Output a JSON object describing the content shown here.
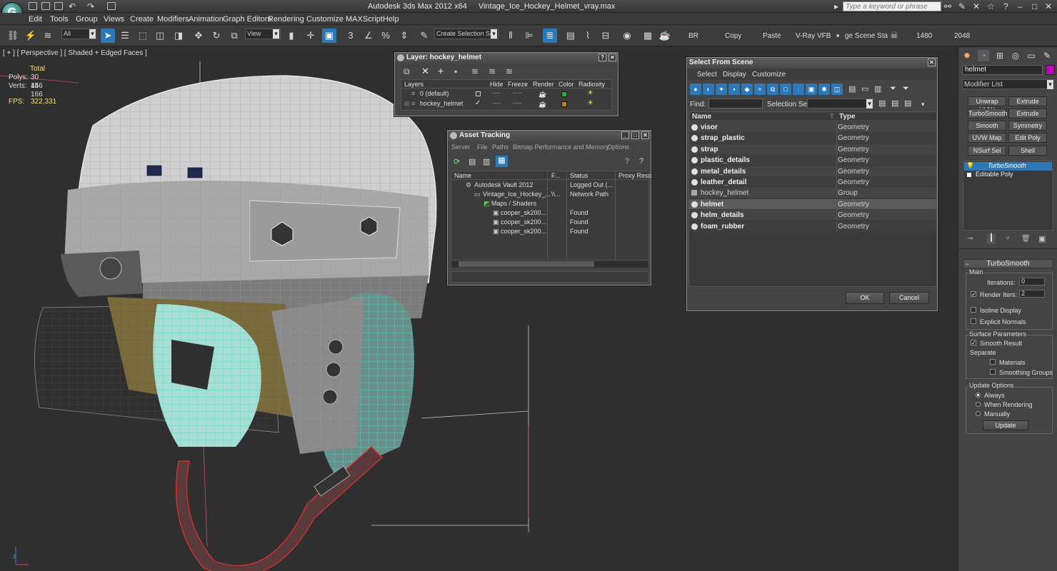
{
  "app": {
    "title": "Autodesk 3ds Max  2012 x64",
    "file": "Vintage_Ice_Hockey_Helmet_vray.max",
    "search_placeholder": "Type a keyword or phrase",
    "logo": "G"
  },
  "menu": [
    "Edit",
    "Tools",
    "Group",
    "Views",
    "Create",
    "Modifiers",
    "Animation",
    "Graph Editors",
    "Rendering",
    "Customize",
    "MAXScript",
    "Help"
  ],
  "toolbar": {
    "filter": "All",
    "ref_coord": "View",
    "selection_set": "Create Selection Se",
    "snap_label": "3",
    "angle_snap": "%",
    "labels": {
      "br": "BR",
      "copy": "Copy",
      "paste": "Paste",
      "vray_vfb": "V-Ray VFB",
      "save_scene": "ge Scene Sta",
      "width": "1480",
      "height": "2048"
    }
  },
  "viewport": {
    "label": "[ + ] [ Perspective ] [ Shaded + Edged Faces ]",
    "stats": {
      "total_label": "Total",
      "polys_label": "Polys:",
      "polys": "30 446",
      "verts_label": "Verts:",
      "verts": "15 166",
      "fps_label": "FPS:",
      "fps": "322,331"
    },
    "axis_label": "z"
  },
  "layer_window": {
    "title": "Layer: hockey_helmet",
    "columns": [
      "Layers",
      "Hide",
      "Freeze",
      "Render",
      "Color",
      "Radiosity"
    ],
    "rows": [
      {
        "name": "0 (default)",
        "color": "#23b14d"
      },
      {
        "name": "hockey_helmet",
        "color": "#b8860b"
      }
    ]
  },
  "asset_window": {
    "title": "Asset Tracking",
    "menu": [
      "Server",
      "File",
      "Paths",
      "Bitmap Performance and Memory",
      "Options"
    ],
    "columns": [
      "Name",
      "F...",
      "Status",
      "Proxy Reso"
    ],
    "rows": [
      {
        "name": "Autodesk Vault 2012",
        "f": "",
        "status": "Logged Out (..."
      },
      {
        "name": "Vintage_Ice_Hockey_...",
        "f": "\\\\...",
        "status": "Network Path"
      },
      {
        "name": "Maps / Shaders",
        "f": "",
        "status": ""
      },
      {
        "name": "cooper_sk200...",
        "f": "",
        "status": "Found"
      },
      {
        "name": "cooper_sk200...",
        "f": "",
        "status": "Found"
      },
      {
        "name": "cooper_sk200...",
        "f": "",
        "status": "Found"
      }
    ]
  },
  "select_window": {
    "title": "Select From Scene",
    "menu": [
      "Select",
      "Display",
      "Customize"
    ],
    "find_label": "Find:",
    "selection_set_label": "Selection Set:",
    "columns": [
      "Name",
      "Type"
    ],
    "rows": [
      {
        "name": "visor",
        "type": "Geometry",
        "group": false,
        "selected": false
      },
      {
        "name": "strap_plastic",
        "type": "Geometry",
        "group": false,
        "selected": false
      },
      {
        "name": "strap",
        "type": "Geometry",
        "group": false,
        "selected": false
      },
      {
        "name": "plastic_details",
        "type": "Geometry",
        "group": false,
        "selected": false
      },
      {
        "name": "metal_details",
        "type": "Geometry",
        "group": false,
        "selected": false
      },
      {
        "name": "leather_detail",
        "type": "Geometry",
        "group": false,
        "selected": false
      },
      {
        "name": "hockey_helmet",
        "type": "Group",
        "group": true,
        "selected": false
      },
      {
        "name": "helmet",
        "type": "Geometry",
        "group": false,
        "selected": true
      },
      {
        "name": "helm_details",
        "type": "Geometry",
        "group": false,
        "selected": false
      },
      {
        "name": "foam_rubber",
        "type": "Geometry",
        "group": false,
        "selected": false
      }
    ],
    "ok": "OK",
    "cancel": "Cancel"
  },
  "command_panel": {
    "object_name": "helmet",
    "object_color": "#c000c0",
    "modifier_list": "Modifier List",
    "modifier_buttons": [
      "Unwrap UVW",
      "Extrude",
      "TurboSmooth",
      "Extrude",
      "Smooth",
      "Symmetry",
      "UVW Map",
      "Edit Poly",
      "NSurf Sel",
      "Shell"
    ],
    "stack": [
      "TurboSmooth",
      "Editable Poly"
    ],
    "rollout_title": "TurboSmooth",
    "main_label": "Main",
    "iterations_label": "Iterations:",
    "iterations": "0",
    "render_iters_label": "Render Iters:",
    "render_iters": "2",
    "isoline": "Isoline Display",
    "explicit_normals": "Explicit Normals",
    "surface_params": "Surface Parameters",
    "smooth_result": "Smooth Result",
    "separate": "Separate",
    "materials": "Materials",
    "smoothing_groups": "Smoothing Groups",
    "update_options": "Update Options",
    "always": "Always",
    "when_rendering": "When Rendering",
    "manually": "Manually",
    "update": "Update"
  }
}
